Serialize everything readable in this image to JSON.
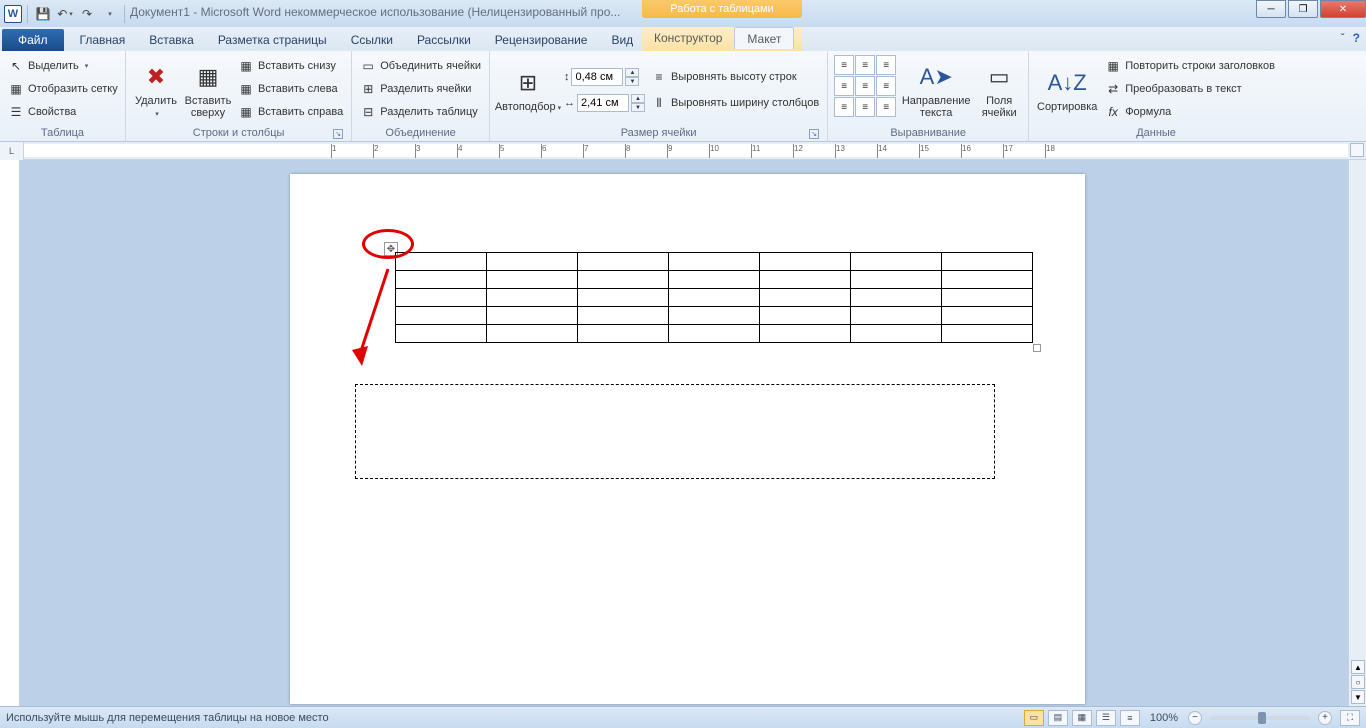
{
  "title": "Документ1 - Microsoft Word некоммерческое использование (Нелицензированный про...",
  "context_title": "Работа с таблицами",
  "tabs": {
    "file": "Файл",
    "home": "Главная",
    "insert": "Вставка",
    "layout": "Разметка страницы",
    "refs": "Ссылки",
    "mail": "Рассылки",
    "review": "Рецензирование",
    "view": "Вид",
    "design": "Конструктор",
    "tlayout": "Макет"
  },
  "groups": {
    "table": {
      "label": "Таблица",
      "select": "Выделить",
      "grid": "Отобразить сетку",
      "props": "Свойства"
    },
    "rowscols": {
      "label": "Строки и столбцы",
      "delete": "Удалить",
      "insert_above": "Вставить сверху",
      "insert_below": "Вставить снизу",
      "insert_left": "Вставить слева",
      "insert_right": "Вставить справа"
    },
    "merge": {
      "label": "Объединение",
      "merge_cells": "Объединить ячейки",
      "split_cells": "Разделить ячейки",
      "split_table": "Разделить таблицу"
    },
    "cellsize": {
      "label": "Размер ячейки",
      "autofit": "Автоподбор",
      "height": "0,48 см",
      "width": "2,41 см",
      "dist_rows": "Выровнять высоту строк",
      "dist_cols": "Выровнять ширину столбцов"
    },
    "align": {
      "label": "Выравнивание",
      "direction": "Направление текста",
      "margins": "Поля ячейки"
    },
    "data": {
      "label": "Данные",
      "sort": "Сортировка",
      "repeat": "Повторить строки заголовков",
      "convert": "Преобразовать в текст",
      "formula": "Формула"
    }
  },
  "status": {
    "text": "Используйте мышь для перемещения таблицы на новое место",
    "zoom": "100%"
  },
  "doc_table": {
    "rows": 5,
    "cols": 7
  }
}
